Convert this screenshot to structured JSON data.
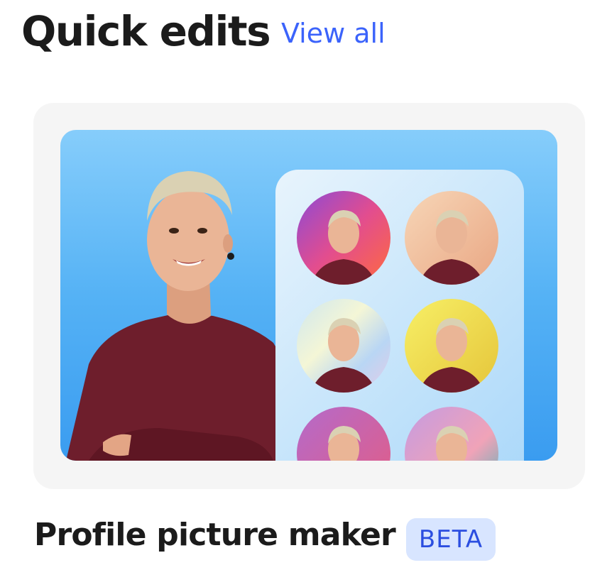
{
  "header": {
    "title": "Quick edits",
    "view_all_label": "View all"
  },
  "card": {
    "image_icon": "profile-portrait-illustration",
    "title": "Profile picture maker",
    "badge": "BETA"
  },
  "colors": {
    "link": "#3b63fb",
    "badge_bg": "#d8e5ff",
    "badge_text": "#2b4ee0",
    "card_bg": "#f5f5f5",
    "image_bg": "#55b2f5",
    "shirt": "#6e1e2c"
  }
}
